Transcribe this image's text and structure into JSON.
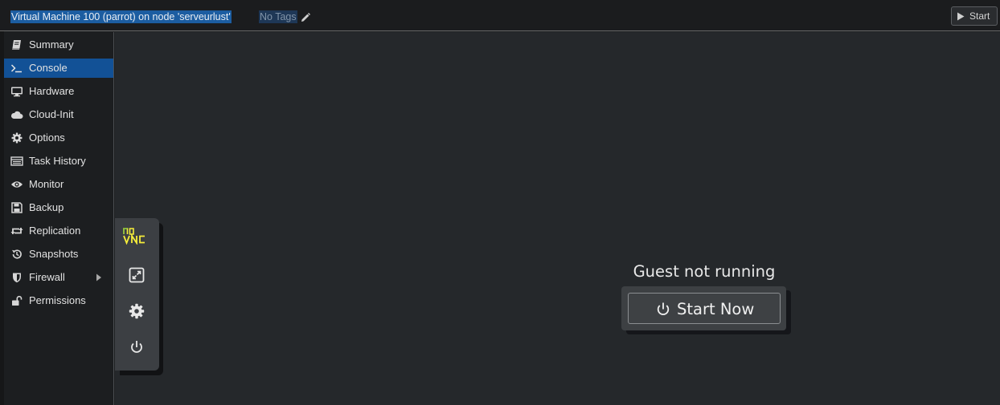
{
  "header": {
    "title": "Virtual Machine 100 (parrot) on node 'serveurlust'",
    "tags": "No Tags",
    "start_label": "Start"
  },
  "sidebar": {
    "items": [
      {
        "label": "Summary",
        "icon": "book-icon"
      },
      {
        "label": "Console",
        "icon": "terminal-icon",
        "active": true
      },
      {
        "label": "Hardware",
        "icon": "monitor-icon"
      },
      {
        "label": "Cloud-Init",
        "icon": "cloud-icon"
      },
      {
        "label": "Options",
        "icon": "gear-icon"
      },
      {
        "label": "Task History",
        "icon": "list-icon"
      },
      {
        "label": "Monitor",
        "icon": "eye-icon"
      },
      {
        "label": "Backup",
        "icon": "floppy-icon"
      },
      {
        "label": "Replication",
        "icon": "retweet-icon"
      },
      {
        "label": "Snapshots",
        "icon": "history-icon"
      },
      {
        "label": "Firewall",
        "icon": "shield-icon",
        "has_submenu": true
      },
      {
        "label": "Permissions",
        "icon": "unlock-icon"
      }
    ]
  },
  "novnc": {
    "logo_top": "no",
    "logo_bottom": "VNC",
    "controls": [
      "fullscreen-icon",
      "settings-icon",
      "power-icon"
    ]
  },
  "console": {
    "message": "Guest not running",
    "start_now_label": "Start Now"
  },
  "colors": {
    "accent": "#125196",
    "title_highlight": "#1c5da1",
    "novnc_logo": "#f6ee3a",
    "novnc_logo_accent": "#3ec13e"
  }
}
